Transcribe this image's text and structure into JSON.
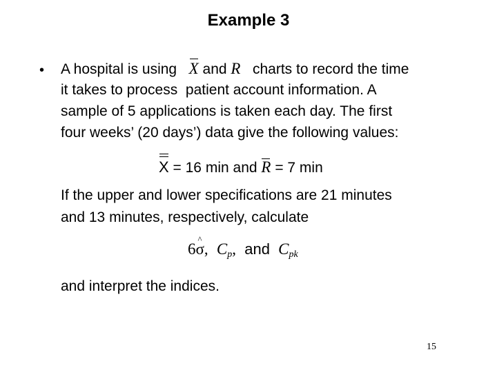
{
  "slide": {
    "title": "Example 3",
    "bullet_glyph": "•",
    "paragraph1": {
      "line1_prefix": "A hospital is using",
      "xbar_symbol": "X",
      "and_word": "and",
      "r_symbol": "R",
      "line1_suffix": "charts to record the time",
      "line2": "it takes to process  patient account information. A",
      "line3": "sample of 5 applications is taken each day. The first",
      "line4": "four weeks’ (20 days’) data give the following values:"
    },
    "equation1": {
      "xbarbar_symbol": "X",
      "xbarbar_value": "= 16 min",
      "connector": "and",
      "rbar_symbol": "R",
      "rbar_value": "= 7 min"
    },
    "paragraph2": {
      "line1": "If the upper and lower specifications are 21 minutes",
      "line2": "and 13 minutes, respectively, calculate"
    },
    "equation2": {
      "six": "6",
      "sigma": "σ",
      "hat": "^",
      "comma1": ",",
      "cp_symbol": "C",
      "cp_sub": "p",
      "comma2": ",",
      "and_word": "and",
      "cpk_symbol": "C",
      "cpk_sub": "pk"
    },
    "paragraph3": {
      "line1": "and interpret the indices."
    },
    "page_number": "15"
  }
}
